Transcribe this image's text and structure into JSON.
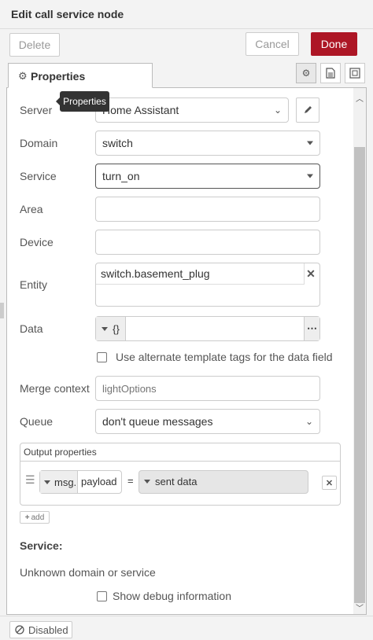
{
  "header": {
    "title": "Edit call service node"
  },
  "toolbar": {
    "delete_label": "Delete",
    "cancel_label": "Cancel",
    "done_label": "Done"
  },
  "tabs": {
    "properties_label": "Properties",
    "tooltip": "Properties"
  },
  "form": {
    "server": {
      "label": "Server",
      "value": "Home Assistant"
    },
    "domain": {
      "label": "Domain",
      "value": "switch"
    },
    "service": {
      "label": "Service",
      "value": "turn_on"
    },
    "area": {
      "label": "Area",
      "value": ""
    },
    "device": {
      "label": "Device",
      "value": ""
    },
    "entity": {
      "label": "Entity",
      "value": "switch.basement_plug"
    },
    "data": {
      "label": "Data",
      "type_glyph": "{}"
    },
    "alt_template": {
      "label": "Use alternate template tags for the data field",
      "checked": false
    },
    "merge_context": {
      "label": "Merge context",
      "placeholder": "lightOptions"
    },
    "queue": {
      "label": "Queue",
      "value": "don't queue messages"
    }
  },
  "output_properties": {
    "title": "Output properties",
    "rows": [
      {
        "prefix": "msg.",
        "property": "payload",
        "equals": "=",
        "value": "sent data"
      }
    ],
    "add_label": "add"
  },
  "service_info": {
    "heading": "Service:",
    "message": "Unknown domain or service"
  },
  "debug": {
    "label": "Show debug information",
    "checked": false
  },
  "footer": {
    "disabled_label": "Disabled"
  },
  "colors": {
    "accent": "#ad1625"
  }
}
